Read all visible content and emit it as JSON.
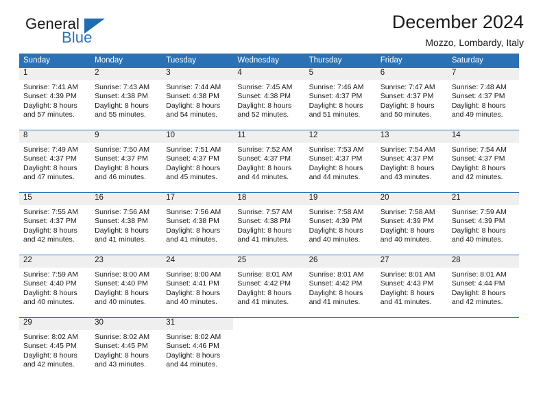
{
  "brand": {
    "name_part1": "General",
    "name_part2": "Blue",
    "accent_color": "#2a72b5"
  },
  "header": {
    "month_title": "December 2024",
    "location": "Mozzo, Lombardy, Italy"
  },
  "calendar": {
    "weekday_headers": [
      "Sunday",
      "Monday",
      "Tuesday",
      "Wednesday",
      "Thursday",
      "Friday",
      "Saturday"
    ],
    "header_background": "#2a72b5",
    "day_band_background": "#efefef",
    "weeks": [
      [
        {
          "day": "1",
          "sunrise": "Sunrise: 7:41 AM",
          "sunset": "Sunset: 4:39 PM",
          "daylight_line1": "Daylight: 8 hours",
          "daylight_line2": "and 57 minutes."
        },
        {
          "day": "2",
          "sunrise": "Sunrise: 7:43 AM",
          "sunset": "Sunset: 4:38 PM",
          "daylight_line1": "Daylight: 8 hours",
          "daylight_line2": "and 55 minutes."
        },
        {
          "day": "3",
          "sunrise": "Sunrise: 7:44 AM",
          "sunset": "Sunset: 4:38 PM",
          "daylight_line1": "Daylight: 8 hours",
          "daylight_line2": "and 54 minutes."
        },
        {
          "day": "4",
          "sunrise": "Sunrise: 7:45 AM",
          "sunset": "Sunset: 4:38 PM",
          "daylight_line1": "Daylight: 8 hours",
          "daylight_line2": "and 52 minutes."
        },
        {
          "day": "5",
          "sunrise": "Sunrise: 7:46 AM",
          "sunset": "Sunset: 4:37 PM",
          "daylight_line1": "Daylight: 8 hours",
          "daylight_line2": "and 51 minutes."
        },
        {
          "day": "6",
          "sunrise": "Sunrise: 7:47 AM",
          "sunset": "Sunset: 4:37 PM",
          "daylight_line1": "Daylight: 8 hours",
          "daylight_line2": "and 50 minutes."
        },
        {
          "day": "7",
          "sunrise": "Sunrise: 7:48 AM",
          "sunset": "Sunset: 4:37 PM",
          "daylight_line1": "Daylight: 8 hours",
          "daylight_line2": "and 49 minutes."
        }
      ],
      [
        {
          "day": "8",
          "sunrise": "Sunrise: 7:49 AM",
          "sunset": "Sunset: 4:37 PM",
          "daylight_line1": "Daylight: 8 hours",
          "daylight_line2": "and 47 minutes."
        },
        {
          "day": "9",
          "sunrise": "Sunrise: 7:50 AM",
          "sunset": "Sunset: 4:37 PM",
          "daylight_line1": "Daylight: 8 hours",
          "daylight_line2": "and 46 minutes."
        },
        {
          "day": "10",
          "sunrise": "Sunrise: 7:51 AM",
          "sunset": "Sunset: 4:37 PM",
          "daylight_line1": "Daylight: 8 hours",
          "daylight_line2": "and 45 minutes."
        },
        {
          "day": "11",
          "sunrise": "Sunrise: 7:52 AM",
          "sunset": "Sunset: 4:37 PM",
          "daylight_line1": "Daylight: 8 hours",
          "daylight_line2": "and 44 minutes."
        },
        {
          "day": "12",
          "sunrise": "Sunrise: 7:53 AM",
          "sunset": "Sunset: 4:37 PM",
          "daylight_line1": "Daylight: 8 hours",
          "daylight_line2": "and 44 minutes."
        },
        {
          "day": "13",
          "sunrise": "Sunrise: 7:54 AM",
          "sunset": "Sunset: 4:37 PM",
          "daylight_line1": "Daylight: 8 hours",
          "daylight_line2": "and 43 minutes."
        },
        {
          "day": "14",
          "sunrise": "Sunrise: 7:54 AM",
          "sunset": "Sunset: 4:37 PM",
          "daylight_line1": "Daylight: 8 hours",
          "daylight_line2": "and 42 minutes."
        }
      ],
      [
        {
          "day": "15",
          "sunrise": "Sunrise: 7:55 AM",
          "sunset": "Sunset: 4:37 PM",
          "daylight_line1": "Daylight: 8 hours",
          "daylight_line2": "and 42 minutes."
        },
        {
          "day": "16",
          "sunrise": "Sunrise: 7:56 AM",
          "sunset": "Sunset: 4:38 PM",
          "daylight_line1": "Daylight: 8 hours",
          "daylight_line2": "and 41 minutes."
        },
        {
          "day": "17",
          "sunrise": "Sunrise: 7:56 AM",
          "sunset": "Sunset: 4:38 PM",
          "daylight_line1": "Daylight: 8 hours",
          "daylight_line2": "and 41 minutes."
        },
        {
          "day": "18",
          "sunrise": "Sunrise: 7:57 AM",
          "sunset": "Sunset: 4:38 PM",
          "daylight_line1": "Daylight: 8 hours",
          "daylight_line2": "and 41 minutes."
        },
        {
          "day": "19",
          "sunrise": "Sunrise: 7:58 AM",
          "sunset": "Sunset: 4:39 PM",
          "daylight_line1": "Daylight: 8 hours",
          "daylight_line2": "and 40 minutes."
        },
        {
          "day": "20",
          "sunrise": "Sunrise: 7:58 AM",
          "sunset": "Sunset: 4:39 PM",
          "daylight_line1": "Daylight: 8 hours",
          "daylight_line2": "and 40 minutes."
        },
        {
          "day": "21",
          "sunrise": "Sunrise: 7:59 AM",
          "sunset": "Sunset: 4:39 PM",
          "daylight_line1": "Daylight: 8 hours",
          "daylight_line2": "and 40 minutes."
        }
      ],
      [
        {
          "day": "22",
          "sunrise": "Sunrise: 7:59 AM",
          "sunset": "Sunset: 4:40 PM",
          "daylight_line1": "Daylight: 8 hours",
          "daylight_line2": "and 40 minutes."
        },
        {
          "day": "23",
          "sunrise": "Sunrise: 8:00 AM",
          "sunset": "Sunset: 4:40 PM",
          "daylight_line1": "Daylight: 8 hours",
          "daylight_line2": "and 40 minutes."
        },
        {
          "day": "24",
          "sunrise": "Sunrise: 8:00 AM",
          "sunset": "Sunset: 4:41 PM",
          "daylight_line1": "Daylight: 8 hours",
          "daylight_line2": "and 40 minutes."
        },
        {
          "day": "25",
          "sunrise": "Sunrise: 8:01 AM",
          "sunset": "Sunset: 4:42 PM",
          "daylight_line1": "Daylight: 8 hours",
          "daylight_line2": "and 41 minutes."
        },
        {
          "day": "26",
          "sunrise": "Sunrise: 8:01 AM",
          "sunset": "Sunset: 4:42 PM",
          "daylight_line1": "Daylight: 8 hours",
          "daylight_line2": "and 41 minutes."
        },
        {
          "day": "27",
          "sunrise": "Sunrise: 8:01 AM",
          "sunset": "Sunset: 4:43 PM",
          "daylight_line1": "Daylight: 8 hours",
          "daylight_line2": "and 41 minutes."
        },
        {
          "day": "28",
          "sunrise": "Sunrise: 8:01 AM",
          "sunset": "Sunset: 4:44 PM",
          "daylight_line1": "Daylight: 8 hours",
          "daylight_line2": "and 42 minutes."
        }
      ],
      [
        {
          "day": "29",
          "sunrise": "Sunrise: 8:02 AM",
          "sunset": "Sunset: 4:45 PM",
          "daylight_line1": "Daylight: 8 hours",
          "daylight_line2": "and 42 minutes."
        },
        {
          "day": "30",
          "sunrise": "Sunrise: 8:02 AM",
          "sunset": "Sunset: 4:45 PM",
          "daylight_line1": "Daylight: 8 hours",
          "daylight_line2": "and 43 minutes."
        },
        {
          "day": "31",
          "sunrise": "Sunrise: 8:02 AM",
          "sunset": "Sunset: 4:46 PM",
          "daylight_line1": "Daylight: 8 hours",
          "daylight_line2": "and 44 minutes."
        },
        {
          "day": "",
          "sunrise": "",
          "sunset": "",
          "daylight_line1": "",
          "daylight_line2": ""
        },
        {
          "day": "",
          "sunrise": "",
          "sunset": "",
          "daylight_line1": "",
          "daylight_line2": ""
        },
        {
          "day": "",
          "sunrise": "",
          "sunset": "",
          "daylight_line1": "",
          "daylight_line2": ""
        },
        {
          "day": "",
          "sunrise": "",
          "sunset": "",
          "daylight_line1": "",
          "daylight_line2": ""
        }
      ]
    ]
  }
}
